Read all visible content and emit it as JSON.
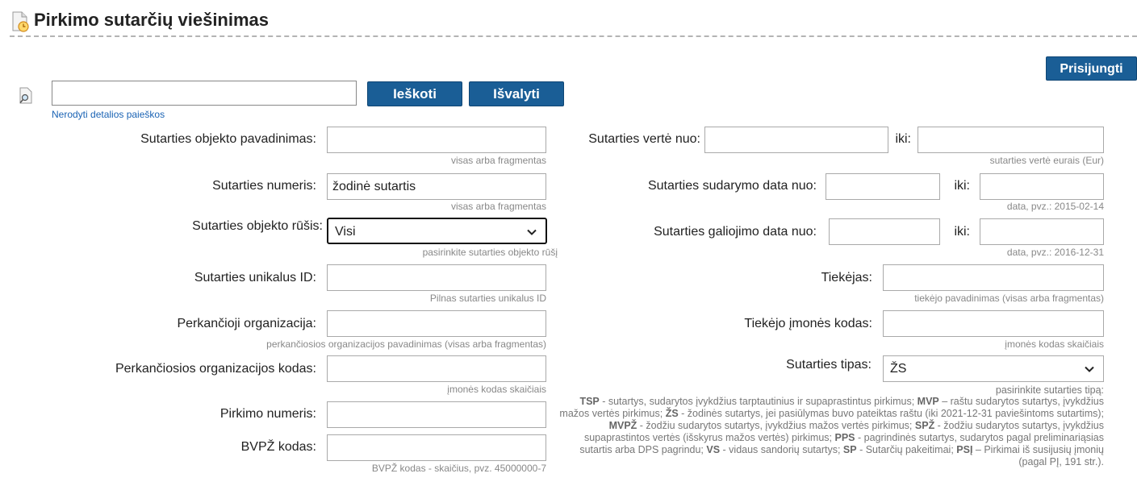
{
  "page": {
    "title": "Pirkimo sutarčių viešinimas",
    "login_button": "Prisijungti"
  },
  "search": {
    "query": "",
    "search_button": "Ieškoti",
    "clear_button": "Išvalyti",
    "toggle_link": "Nerodyti detalios paieškos"
  },
  "left": {
    "object_name": {
      "label": "Sutarties objekto pavadinimas:",
      "value": "",
      "hint": "visas arba fragmentas"
    },
    "contract_number": {
      "label": "Sutarties numeris:",
      "value": "žodinė sutartis",
      "hint": "visas arba fragmentas"
    },
    "object_type": {
      "label": "Sutarties objekto rūšis:",
      "value": "Visi",
      "hint": "pasirinkite sutarties objekto rūšį"
    },
    "unique_id": {
      "label": "Sutarties unikalus ID:",
      "value": "",
      "hint": "Pilnas sutarties unikalus ID"
    },
    "buyer_org": {
      "label": "Perkančioji organizacija:",
      "value": "",
      "hint": "perkančiosios organizacijos pavadinimas (visas arba fragmentas)"
    },
    "buyer_code": {
      "label": "Perkančiosios organizacijos kodas:",
      "value": "",
      "hint": "įmonės kodas skaičiais"
    },
    "procurement_number": {
      "label": "Pirkimo numeris:",
      "value": ""
    },
    "cpv_code": {
      "label": "BVPŽ kodas:",
      "value": "",
      "hint": "BVPŽ kodas - skaičius, pvz. 45000000-7"
    }
  },
  "right": {
    "value_from": {
      "label": "Sutarties vertė nuo:",
      "value": "",
      "to_label": "iki:",
      "to_value": "",
      "hint": "sutarties vertė eurais (Eur)"
    },
    "signed_date": {
      "label": "Sutarties sudarymo data nuo:",
      "value": "",
      "to_label": "iki:",
      "to_value": "",
      "hint": "data, pvz.: 2015-02-14"
    },
    "valid_date": {
      "label": "Sutarties galiojimo data nuo:",
      "value": "",
      "to_label": "iki:",
      "to_value": "",
      "hint": "data, pvz.: 2016-12-31"
    },
    "supplier": {
      "label": "Tiekėjas:",
      "value": "",
      "hint": "tiekėjo pavadinimas (visas arba fragmentas)"
    },
    "supplier_code": {
      "label": "Tiekėjo įmonės kodas:",
      "value": "",
      "hint": "įmonės kodas skaičiais"
    },
    "contract_type": {
      "label": "Sutarties tipas:",
      "value": "ŽS",
      "hint": "pasirinkite sutarties tipą:"
    }
  },
  "type_description": [
    {
      "code": "TSP",
      "text": " - sutartys, sudarytos įvykdžius tarptautinius ir supaprastintus pirkimus; "
    },
    {
      "code": "MVP",
      "text": " – raštu sudarytos sutartys, įvykdžius mažos vertės pirkimus; "
    },
    {
      "code": "ŽS",
      "text": " - žodinės sutartys, jei pasiūlymas buvo pateiktas raštu (iki 2021-12-31 paviešintoms sutartims); "
    },
    {
      "code": "MVPŽ",
      "text": " - žodžiu sudarytos sutartys, įvykdžius mažos vertės pirkimus; "
    },
    {
      "code": "SPŽ",
      "text": " - žodžiu sudarytos sutartys, įvykdžius supaprastintos vertės (išskyrus mažos vertės) pirkimus; "
    },
    {
      "code": "PPS",
      "text": " - pagrindinės sutartys, sudarytos pagal preliminariąsias sutartis arba DPS pagrindu; "
    },
    {
      "code": "VS",
      "text": " - vidaus sandorių sutartys; "
    },
    {
      "code": "SP",
      "text": " - Sutarčių pakeitimai; "
    },
    {
      "code": "PSĮ",
      "text": " – Pirkimai iš susijusių įmonių (pagal PĮ, 191 str.)."
    }
  ],
  "colors": {
    "button": "#1a5e96",
    "link": "#1a63b4",
    "hint": "#888888"
  },
  "icons": {
    "title": "document-clock-icon",
    "search": "document-search-icon",
    "dropdown": "chevron-down-icon"
  }
}
